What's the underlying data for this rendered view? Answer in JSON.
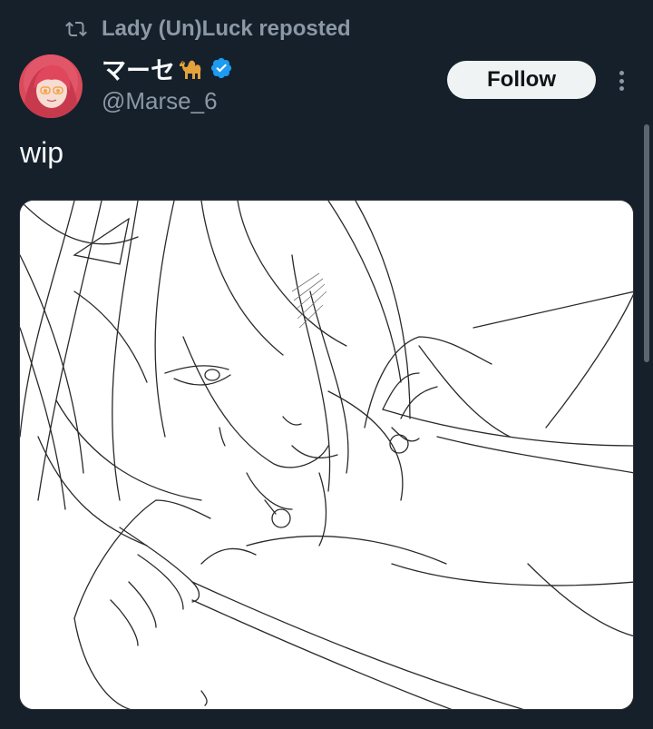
{
  "repost": {
    "icon": "repost-icon",
    "text": "Lady (Un)Luck reposted"
  },
  "author": {
    "display_name": "マーセ",
    "emoji": "camel-emoji",
    "verified_icon": "verified-badge-icon",
    "handle": "@Marse_6",
    "avatar": "avatar-red-haired-anime-girl"
  },
  "actions": {
    "follow_label": "Follow",
    "more_icon": "more-options-icon"
  },
  "tweet": {
    "text": "wip"
  },
  "media": {
    "description_icon": "sketch-image"
  },
  "colors": {
    "background": "#15202b",
    "secondary_text": "#8b98a5",
    "primary_text": "#f7f9f9",
    "verified_blue": "#1d9bf0",
    "follow_bg": "#eff3f4"
  }
}
